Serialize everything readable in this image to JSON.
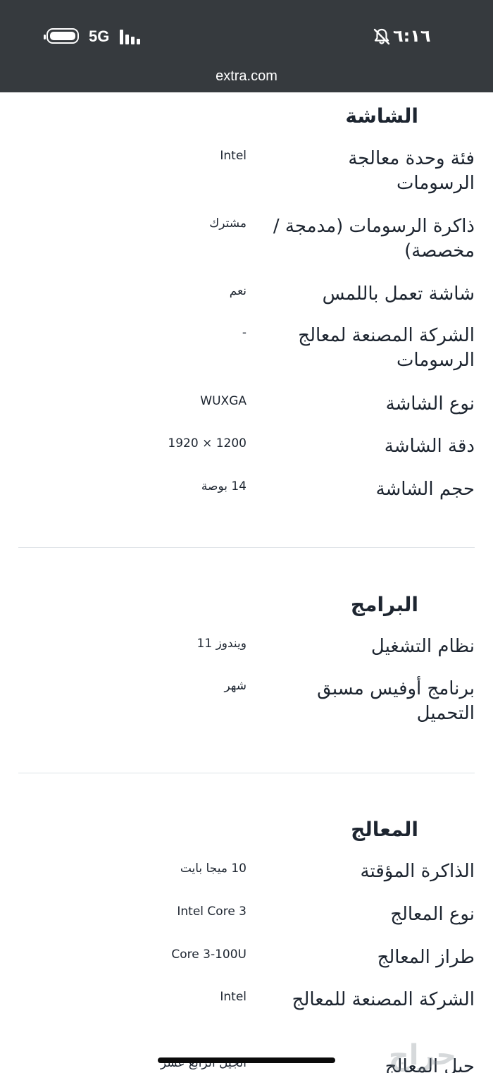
{
  "status_bar": {
    "network": "5G",
    "time": "٦:١٦",
    "url": "extra.com",
    "icons": [
      "battery-icon",
      "signal-icon",
      "mute-icon"
    ]
  },
  "sections": {
    "display": {
      "heading": "الشاشة",
      "rows": [
        {
          "label": "فئة وحدة معالجة الرسومات",
          "value": "Intel"
        },
        {
          "label": "ذاكرة الرسومات (مدمجة / مخصصة)",
          "value": "مشترك"
        },
        {
          "label": "شاشة تعمل باللمس",
          "value": "نعم"
        },
        {
          "label": "الشركة المصنعة لمعالج الرسومات",
          "value": "-"
        },
        {
          "label": "نوع الشاشة",
          "value": "WUXGA"
        },
        {
          "label": "دقة الشاشة",
          "value": "1920 × 1200"
        },
        {
          "label": "حجم الشاشة",
          "value": "14 بوصة"
        }
      ]
    },
    "software": {
      "heading": "البرامج",
      "rows": [
        {
          "label": "نظام التشغيل",
          "value": "ويندوز 11"
        },
        {
          "label": "برنامج أوفيس مسبق التحميل",
          "value": "شهر"
        }
      ]
    },
    "processor": {
      "heading": "المعالج",
      "rows": [
        {
          "label": "الذاكرة المؤقتة",
          "value": "10 ميجا بايت"
        },
        {
          "label": "نوع المعالج",
          "value": "Intel Core 3"
        },
        {
          "label": "طراز المعالج",
          "value": "Core 3-100U"
        },
        {
          "label": "الشركة المصنعة للمعالج",
          "value": "Intel"
        },
        {
          "label": "جيل المعالج",
          "value": "الجيل الرابع عشر"
        }
      ]
    }
  },
  "watermark": "حراج"
}
